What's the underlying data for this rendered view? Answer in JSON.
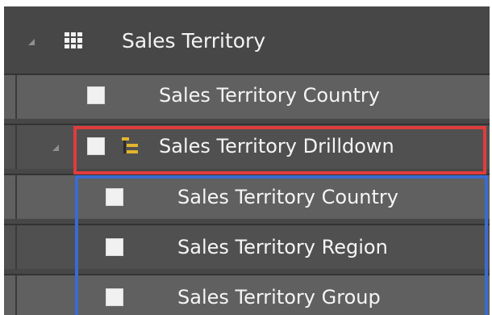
{
  "table": {
    "title": "Sales Territory",
    "icon": "table-icon",
    "expanded": true
  },
  "rows": [
    {
      "label": "Sales Territory Country",
      "checked": false
    },
    {
      "label": "Sales Territory Drilldown",
      "checked": false,
      "icon": "hierarchy-icon",
      "expanded": true
    },
    {
      "label": "Sales Territory Country",
      "checked": false
    },
    {
      "label": "Sales Territory Region",
      "checked": false
    },
    {
      "label": "Sales Territory Group",
      "checked": false
    }
  ],
  "highlights": {
    "hierarchy_color": "#e03c3c",
    "levels_color": "#3a6bd0"
  }
}
